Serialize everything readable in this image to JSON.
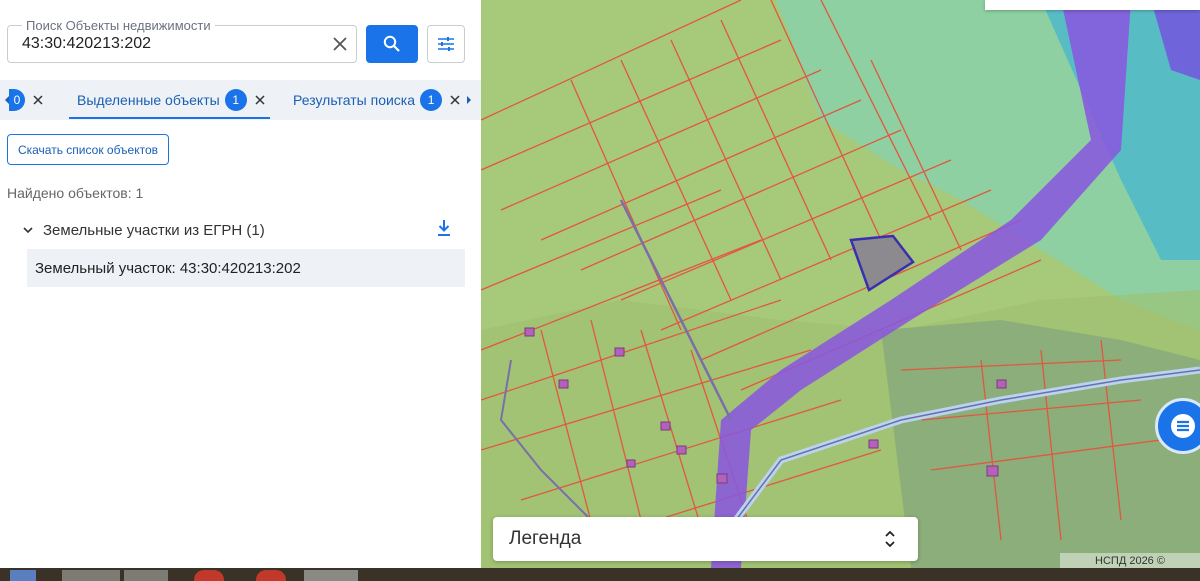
{
  "search": {
    "label": "Поиск Объекты недвижимости",
    "value": "43:30:420213:202"
  },
  "tabs": {
    "partial_count": "0",
    "items": [
      {
        "label": "Выделенные объекты",
        "count": "1"
      },
      {
        "label": "Результаты поиска",
        "count": "1"
      }
    ]
  },
  "download_list_label": "Скачать список объектов",
  "found_text": "Найдено объектов: 1",
  "group": {
    "title": "Земельные участки из ЕГРН (1)",
    "items": [
      {
        "label": "Земельный участок: 43:30:420213:202"
      }
    ]
  },
  "map": {
    "legend_label": "Легенда",
    "copyright": "НСПД 2026 ©"
  },
  "colors": {
    "accent": "#1a73e8",
    "parcel_lines": "#e0473a",
    "zone_purple": "#7b3fe4",
    "selected_parcel": "#3a2fb0"
  }
}
